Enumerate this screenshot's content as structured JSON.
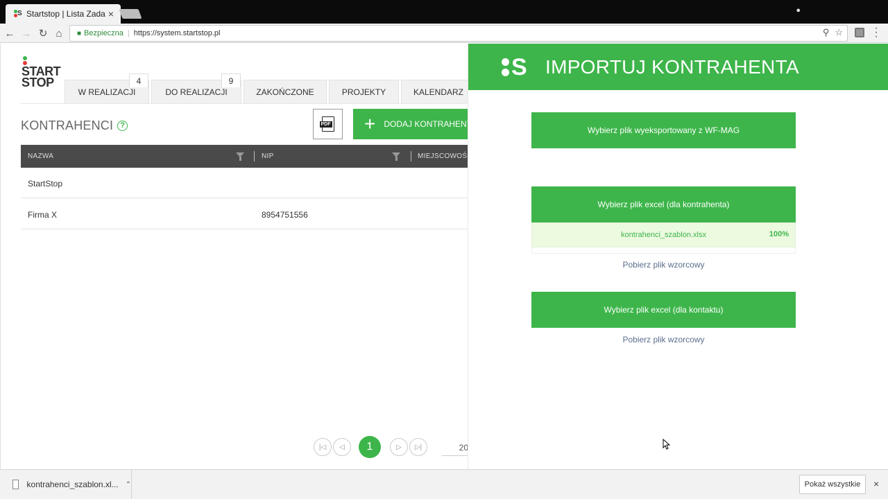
{
  "browser": {
    "tab_title": "Startstop | Lista Zadań",
    "tab_close": "×",
    "secure_label": "Bezpieczna",
    "url": "https://system.startstop.pl"
  },
  "app": {
    "logo_line1": "START",
    "logo_line2": "STOP",
    "nav_tabs": [
      {
        "label": "W REALIZACJI",
        "badge": "4"
      },
      {
        "label": "DO REALIZACJI",
        "badge": "9"
      },
      {
        "label": "ZAKOŃCZONE"
      },
      {
        "label": "PROJEKTY"
      },
      {
        "label": "KALENDARZ"
      }
    ],
    "section_title": "KONTRAHENCI",
    "help_label": "?",
    "pdf_label": "PDF",
    "add_button": "DODAJ KONTRAHENTA",
    "table": {
      "columns": [
        "NAZWA",
        "NIP",
        "MIEJSCOWOŚĆ"
      ],
      "rows": [
        {
          "name": "StartStop",
          "nip": ""
        },
        {
          "name": "Firma X",
          "nip": "8954751556"
        }
      ]
    },
    "pagination": {
      "current": "1",
      "per_page": "20"
    }
  },
  "panel": {
    "title": "IMPORTUJ KONTRAHENTA",
    "btn_wfmag": "Wybierz plik wyeksportowany z WF-MAG",
    "btn_excel_contractor": "Wybierz plik excel (dla kontrahenta)",
    "uploaded_file": "kontrahenci_szablon.xlsx",
    "upload_progress": "100%",
    "link_template_1": "Pobierz plik wzorcowy",
    "btn_excel_contact": "Wybierz plik excel (dla kontaktu)",
    "link_template_2": "Pobierz plik wzorcowy"
  },
  "downloads": {
    "file": "kontrahenci_szablon.xl...",
    "show_all": "Pokaż wszystkie",
    "close": "×"
  },
  "colors": {
    "accent": "#3db54a",
    "header_dark": "#4a4a4a",
    "upload_bg": "#ecfae0"
  },
  "icons": [
    "back-icon",
    "forward-icon",
    "reload-icon",
    "home-icon",
    "lock-icon",
    "zoom-icon",
    "star-icon",
    "filter-icon",
    "pdf-icon",
    "plus-icon",
    "first-page-icon",
    "prev-page-icon",
    "next-page-icon",
    "last-page-icon",
    "file-icon",
    "chevron-up-icon",
    "close-icon"
  ]
}
